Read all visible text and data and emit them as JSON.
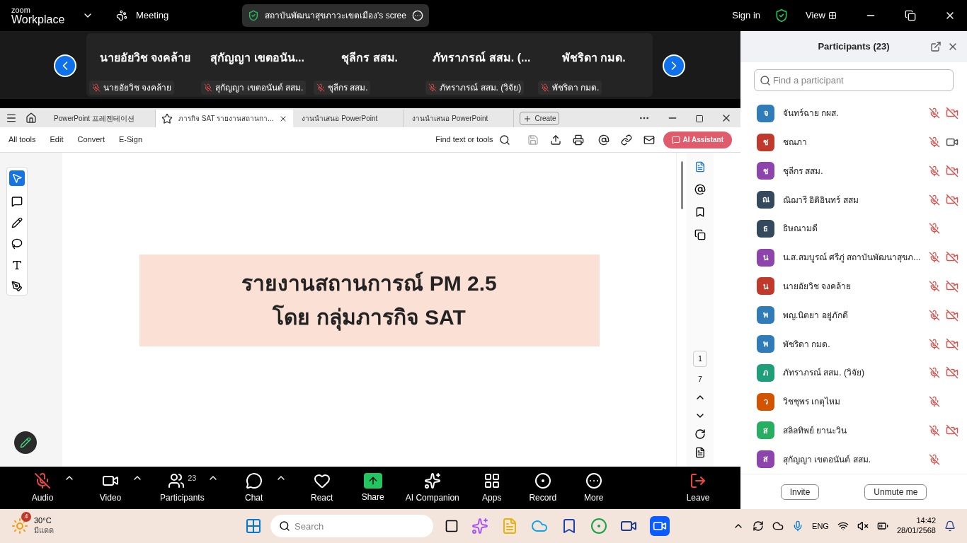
{
  "top_bar": {
    "logo_top": "zoom",
    "logo_bottom": "Workplace",
    "meeting": "Meeting",
    "share_title": "สถาบันพัฒนาสุขภาวะเขตเมือง's scree",
    "sign_in": "Sign in",
    "view": "View"
  },
  "thumbnails": [
    {
      "name": "นายอัยวิช  จงคล้าย",
      "tag": "นายอัยวิช  จงคล้าย",
      "muted": true
    },
    {
      "name": "สุกัญญา เขตอนัน...",
      "tag": "สุกัญญา เขตอนันต์ สสม.",
      "muted": true
    },
    {
      "name": "ชุลีกร สสม.",
      "tag": "ชุลีกร สสม.",
      "muted": true
    },
    {
      "name": "ภัทราภรณ์ สสม. (...",
      "tag": "ภัทราภรณ์ สสม. (วิจัย)",
      "muted": true
    },
    {
      "name": "พัชริดา กมด.",
      "tag": "พัชริดา กมด.",
      "muted": true
    }
  ],
  "pdf": {
    "tabs": [
      {
        "label": "PowerPoint 프레젠테이션",
        "selected": false
      },
      {
        "label": "ภารกิจ  SAT รายงานสถานกา...",
        "selected": true
      },
      {
        "label": "งานนำเสนอ PowerPoint",
        "selected": false
      },
      {
        "label": "งานนำเสนอ PowerPoint",
        "selected": false
      }
    ],
    "create": "Create",
    "menu": [
      "All tools",
      "Edit",
      "Convert",
      "E-Sign"
    ],
    "find": "Find text or tools",
    "ai": "AI Assistant",
    "slide_lines": [
      "รายงานสถานการณ์ PM 2.5",
      "โดย กลุ่มภารกิจ  SAT"
    ],
    "page": "1",
    "pages": "7"
  },
  "toolbar": [
    {
      "kind": "audio",
      "label": "Audio",
      "muted": true,
      "caret": true
    },
    {
      "kind": "video",
      "label": "Video",
      "caret": true
    },
    {
      "kind": "participants",
      "label": "Participants",
      "count": "23",
      "caret": true
    },
    {
      "kind": "chat",
      "label": "Chat",
      "caret": true
    },
    {
      "kind": "react",
      "label": "React",
      "caret": false
    },
    {
      "kind": "share",
      "label": "Share",
      "caret": false
    },
    {
      "kind": "ai",
      "label": "AI Companion",
      "caret": false
    },
    {
      "kind": "apps",
      "label": "Apps",
      "caret": false
    },
    {
      "kind": "record",
      "label": "Record",
      "caret": false
    },
    {
      "kind": "more",
      "label": "More",
      "caret": false
    },
    {
      "kind": "leave",
      "label": "Leave",
      "caret": false
    }
  ],
  "participants": {
    "title": "Participants (23)",
    "search": {
      "placeholder": "Find a participant"
    },
    "items": [
      {
        "initial": "จ",
        "name": "จันทร์ฉาย  กผส.",
        "color": "#2f7cb8",
        "muted": true,
        "video_off": true
      },
      {
        "initial": "ช",
        "name": "ชณภา",
        "color": "#c0392b",
        "muted": true,
        "video_off": false
      },
      {
        "initial": "ช",
        "name": "ชุลีกร สสม.",
        "color": "#8e44ad",
        "muted": true,
        "video_off": true
      },
      {
        "initial": "ณ",
        "name": "ณิฌารี อิติอินทร์ สสม",
        "color": "#34495e",
        "muted": true,
        "video_off": true
      },
      {
        "initial": "ธ",
        "name": "ธิษณามดี",
        "color": "#34495e",
        "muted": true
      },
      {
        "initial": "น",
        "name": "น.ส.สมบูรณ์ ศรีภู่ สถาบันพัฒนาสุขภ...",
        "color": "#8e44ad",
        "muted": true,
        "video_off": true
      },
      {
        "initial": "น",
        "name": "นายอัยวิช  จงคล้าย",
        "color": "#c0392b",
        "muted": true,
        "video_off": true
      },
      {
        "initial": "พ",
        "name": "พญ.นิตยา อยู่ภักดี",
        "color": "#2f7cb8",
        "muted": true,
        "video_off": true
      },
      {
        "initial": "พ",
        "name": "พัชริดา กมด.",
        "color": "#2f7cb8",
        "muted": true,
        "video_off": true
      },
      {
        "initial": "ภ",
        "name": "ภัทราภรณ์ สสม. (วิจัย)",
        "color": "#1f9e7a",
        "muted": true,
        "video_off": true
      },
      {
        "initial": "ว",
        "name": "วิชชุพร เกตุไหม",
        "color": "#d35400",
        "muted": true
      },
      {
        "initial": "ส",
        "name": "สลิลทิพย์ ยานะวิน",
        "color": "#27ae60",
        "muted": true,
        "video_off": true
      },
      {
        "initial": "ส",
        "name": "สุกัญญา เขตอนันต์ สสม.",
        "color": "#8e44ad",
        "muted": true
      }
    ],
    "buttons": [
      "Invite",
      "Unmute me"
    ]
  },
  "taskbar": {
    "badge": "4",
    "temp": "30°C",
    "weather": "มีแดด",
    "search": {
      "placeholder": "Search"
    },
    "lang": "ENG",
    "time": "14:42",
    "date": "28/01/2568"
  }
}
